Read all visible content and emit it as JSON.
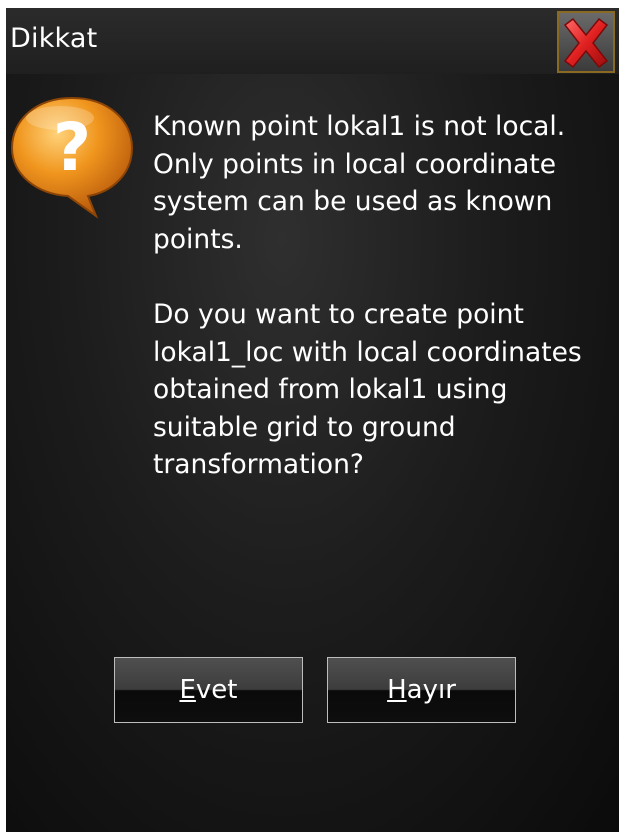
{
  "window": {
    "title": "Dikkat"
  },
  "icons": {
    "close": "close-icon",
    "question": "question-bubble-icon"
  },
  "colors": {
    "background": "#1c1c1c",
    "text": "#ffffff",
    "icon_orange": "#e07b10",
    "close_red": "#d62020"
  },
  "message": {
    "paragraph1": "Known point lokal1 is not local. Only points in local coordinate system can be used as known points.",
    "paragraph2": "Do you want to create point lokal1_loc with local coordinates obtained from lokal1 using suitable grid to ground transformation?"
  },
  "buttons": {
    "yes": {
      "mnemonic": "E",
      "rest": "vet"
    },
    "no": {
      "mnemonic": "H",
      "rest": "ayır"
    }
  }
}
